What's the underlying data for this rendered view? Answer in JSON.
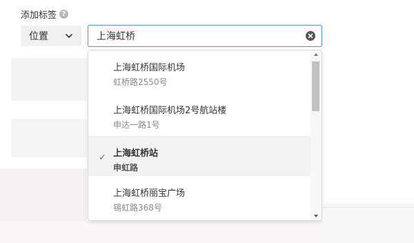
{
  "form": {
    "label": "添加标签",
    "help_icon": "question-circle-icon",
    "type_select": {
      "value": "位置",
      "icon": "chevron-down-icon"
    },
    "search": {
      "value": "上海虹桥",
      "clear_icon": "clear-circle-icon"
    }
  },
  "dropdown": {
    "options": [
      {
        "name": "上海虹桥国际机场",
        "address": "虹桥路2550号",
        "selected": false
      },
      {
        "name": "上海虹桥国际机场2号航站楼",
        "address": "申达一路1号",
        "selected": false
      },
      {
        "name": "上海虹桥站",
        "address": "申虹路",
        "selected": true,
        "check_icon": "checkmark-icon"
      },
      {
        "name": "上海虹桥丽宝广场",
        "address": "锡虹路368号",
        "selected": false
      }
    ]
  },
  "colors": {
    "focus_border": "#4a90d9",
    "selected_bg": "#f2f2f2",
    "secondary_text": "#888888"
  }
}
